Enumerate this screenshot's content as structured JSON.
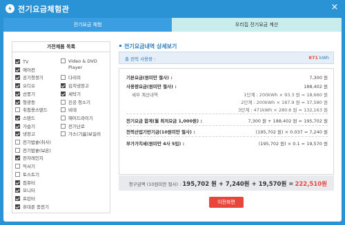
{
  "window": {
    "title": "전기요금체험관",
    "close_glyph": "×"
  },
  "tabs": [
    {
      "label": "전기요금 체험"
    },
    {
      "label": "우리집 전기요금 계산"
    }
  ],
  "appliances": {
    "header": "가전제품 목록",
    "left": [
      {
        "label": "TV",
        "checked": true
      },
      {
        "label": "에어컨",
        "checked": true
      },
      {
        "label": "공기청정기",
        "checked": true
      },
      {
        "label": "오디오",
        "checked": true
      },
      {
        "label": "선풍기",
        "checked": true
      },
      {
        "label": "형광등",
        "checked": true
      },
      {
        "label": "취침용스탠드",
        "checked": false
      },
      {
        "label": "스탠드",
        "checked": true
      },
      {
        "label": "가습기",
        "checked": true
      },
      {
        "label": "냉장고",
        "checked": true
      },
      {
        "label": "전기밥솥(취사)",
        "checked": false
      },
      {
        "label": "전기밥솥(보온)",
        "checked": false
      },
      {
        "label": "전자레인지",
        "checked": true
      },
      {
        "label": "믹서기",
        "checked": false
      },
      {
        "label": "토스트기",
        "checked": false
      },
      {
        "label": "컴퓨터",
        "checked": true
      },
      {
        "label": "모니터",
        "checked": true
      },
      {
        "label": "프린터",
        "checked": true
      },
      {
        "label": "휴대폰 충전기",
        "checked": true
      }
    ],
    "right": [
      {
        "label": "Video & DVD Player",
        "checked": false
      },
      {
        "label": "다리미",
        "checked": false
      },
      {
        "label": "김치냉장고",
        "checked": true
      },
      {
        "label": "세탁기",
        "checked": true
      },
      {
        "label": "진공 청소기",
        "checked": false
      },
      {
        "label": "비데",
        "checked": false
      },
      {
        "label": "헤어드라이기",
        "checked": false
      },
      {
        "label": "전기난로",
        "checked": false
      },
      {
        "label": "가스(기름)보일러",
        "checked": false
      }
    ]
  },
  "details": {
    "section_title": "전기요금내역 상세보기",
    "usage_label": "총 전력 사용량 :",
    "usage_value": "871",
    "usage_unit": "kWh",
    "rows": [
      {
        "label": "기본요금(원미만 절사) :",
        "value": "7,300 원",
        "style": "bold"
      },
      {
        "label": "사용량요금(원미만 절사) :",
        "value": "188,402 원",
        "style": "bold"
      },
      {
        "label": "세부 계산내역",
        "value": "1단계 : 200kWh × 93.3 원 = 18,660 원",
        "style": "sub"
      },
      {
        "label": "",
        "value": "2단계 : 200kWh × 187.9 원 = 37,580 원",
        "style": "sub"
      },
      {
        "label": "",
        "value": "3단계 : 471kWh × 280.6 원 = 132,163 원",
        "style": "sub"
      },
      {
        "label": "전기요금 합계(월 최저요금 1,000원) :",
        "value": "7,300 원 + 188,402 원 = 195,702 원",
        "style": "bold"
      },
      {
        "label": "전력산업기반기금(10원미만 절사) :",
        "value": "(195,702 원) × 0.037 = 7,240 원",
        "style": "bold"
      },
      {
        "label": "부가가치세(원미만 4사 5입) :",
        "value": "(195,702 원) × 0.1 = 19,570 원",
        "style": "bold"
      }
    ],
    "total_label": "청구금액 (10원미만 절사) :",
    "total_expr": "195,702 원 + 7,240원 + 19,570원 =",
    "total_value": "222,510원",
    "button_label": "이전화면"
  },
  "colors": {
    "accent": "#2a93d5",
    "tab_active": "#c9ecec",
    "highlight": "#e8453c"
  }
}
